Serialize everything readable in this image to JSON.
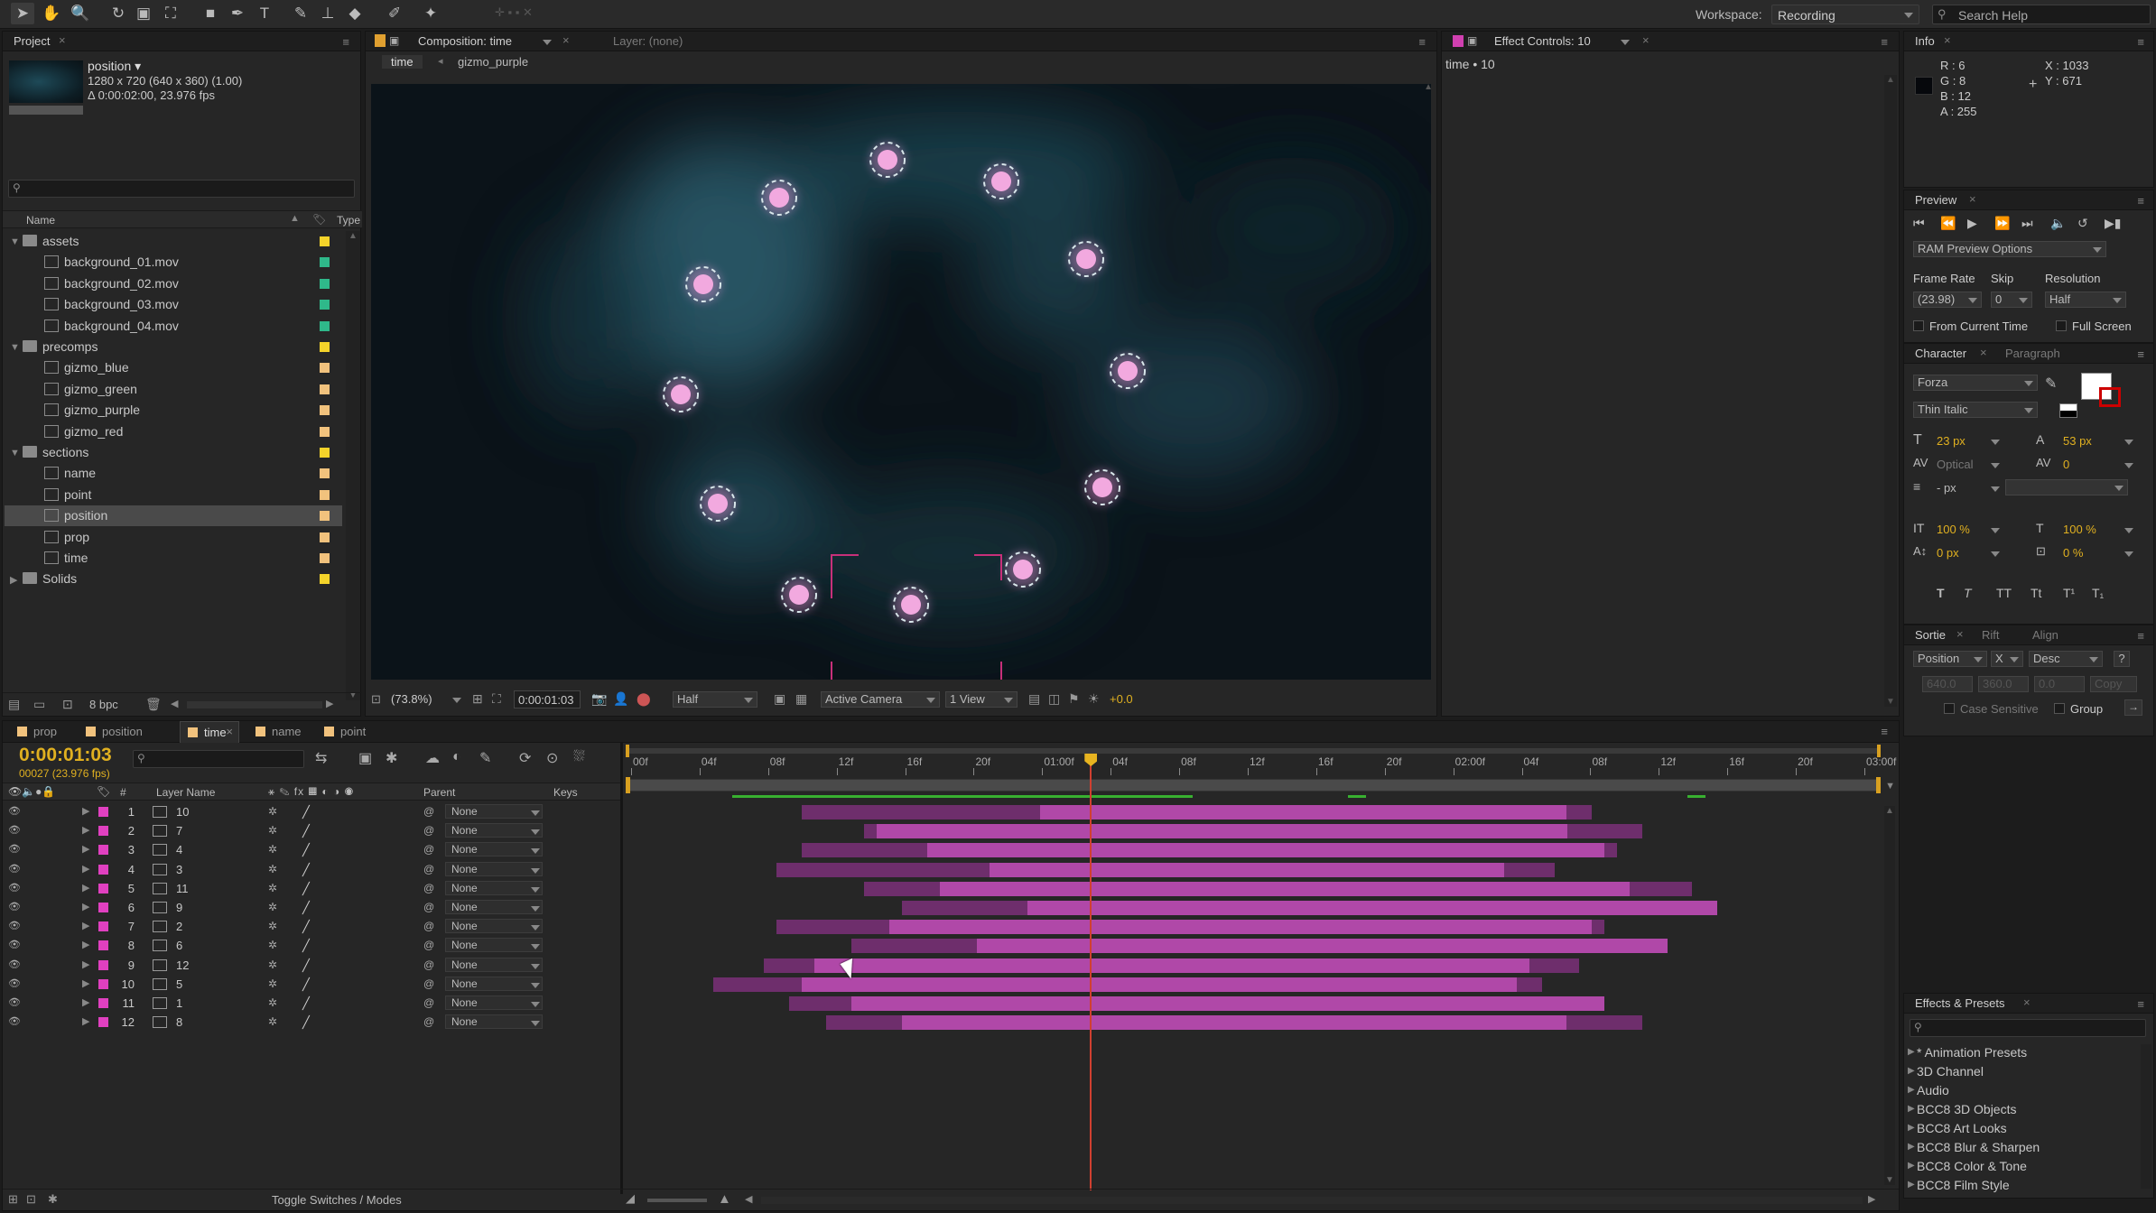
{
  "toolbar": {
    "workspace_label": "Workspace:",
    "workspace_value": "Recording",
    "search_placeholder": "Search Help"
  },
  "project": {
    "tab": "Project",
    "item_name": "position ▾",
    "item_res": "1280 x 720  (640 x 360) (1.00)",
    "item_dur": "Δ 0:00:02:00, 23.976 fps",
    "col_name": "Name",
    "col_type": "Type",
    "bpc": "8 bpc",
    "rows": [
      {
        "label": "assets",
        "kind": "folder",
        "color": "#f4d32a",
        "open": true
      },
      {
        "label": "background_01.mov",
        "kind": "file",
        "color": "#2fb88a"
      },
      {
        "label": "background_02.mov",
        "kind": "file",
        "color": "#2fb88a"
      },
      {
        "label": "background_03.mov",
        "kind": "file",
        "color": "#2fb88a"
      },
      {
        "label": "background_04.mov",
        "kind": "file",
        "color": "#2fb88a"
      },
      {
        "label": "precomps",
        "kind": "folder",
        "color": "#f4d32a",
        "open": true
      },
      {
        "label": "gizmo_blue",
        "kind": "comp",
        "color": "#f1c27d"
      },
      {
        "label": "gizmo_green",
        "kind": "comp",
        "color": "#f1c27d"
      },
      {
        "label": "gizmo_purple",
        "kind": "comp",
        "color": "#f1c27d"
      },
      {
        "label": "gizmo_red",
        "kind": "comp",
        "color": "#f1c27d"
      },
      {
        "label": "sections",
        "kind": "folder",
        "color": "#f4d32a",
        "open": true
      },
      {
        "label": "name",
        "kind": "comp",
        "color": "#f1c27d"
      },
      {
        "label": "point",
        "kind": "comp",
        "color": "#f1c27d"
      },
      {
        "label": "position",
        "kind": "comp",
        "color": "#f1c27d",
        "selected": true
      },
      {
        "label": "prop",
        "kind": "comp",
        "color": "#f1c27d"
      },
      {
        "label": "time",
        "kind": "comp",
        "color": "#f1c27d"
      },
      {
        "label": "Solids",
        "kind": "folder",
        "color": "#f4d32a",
        "open": false
      }
    ]
  },
  "composition": {
    "tab": "Composition: time",
    "layer_tab": "Layer: (none)",
    "crumb_active": "time",
    "crumb_next": "gizmo_purple",
    "zoom": "(73.8%)",
    "timecode": "0:00:01:03",
    "resolution": "Half",
    "camera": "Active Camera",
    "view": "1 View",
    "exposure": "+0.0"
  },
  "effect_controls": {
    "tab": "Effect Controls: 10",
    "title": "time • 10"
  },
  "info": {
    "tab": "Info",
    "r": "R : 6",
    "g": "G : 8",
    "b": "B : 12",
    "a": "A : 255",
    "x": "X : 1033",
    "y": "Y : 671"
  },
  "preview": {
    "tab": "Preview",
    "ram": "RAM Preview Options",
    "frame_rate_label": "Frame Rate",
    "skip_label": "Skip",
    "resolution_label": "Resolution",
    "frame_rate": "(23.98)",
    "skip": "0",
    "resolution": "Half",
    "from_current": "From Current Time",
    "full_screen": "Full Screen"
  },
  "character": {
    "tab": "Character",
    "tab2": "Paragraph",
    "font": "Forza",
    "style": "Thin Italic",
    "size": "23 px",
    "leading": "53 px",
    "kerning": "Optical",
    "tracking": "0",
    "stroke": "- px",
    "vscale": "100 %",
    "hscale": "100 %",
    "baseline": "0 px",
    "tsume": "0 %",
    "type_buttons": [
      "T",
      "T",
      "TT",
      "Tt",
      "T¹",
      "T₁"
    ]
  },
  "sortie": {
    "tab": "Sortie",
    "tab2": "Rift",
    "tab3": "Align",
    "property": "Position",
    "axis": "X",
    "order": "Desc",
    "help": "?",
    "f1": "640.0",
    "f2": "360.0",
    "f3": "0.0",
    "copy": "Copy",
    "case": "Case Sensitive",
    "group": "Group"
  },
  "effects": {
    "tab": "Effects & Presets",
    "items": [
      "* Animation Presets",
      "3D Channel",
      "Audio",
      "BCC8 3D Objects",
      "BCC8 Art Looks",
      "BCC8 Blur & Sharpen",
      "BCC8 Color & Tone",
      "BCC8 Film Style"
    ]
  },
  "timeline": {
    "tabs": [
      {
        "label": "prop",
        "active": false
      },
      {
        "label": "position",
        "active": false
      },
      {
        "label": "time",
        "active": true
      },
      {
        "label": "name",
        "active": false
      },
      {
        "label": "point",
        "active": false
      }
    ],
    "timecode": "0:00:01:03",
    "frames": "00027 (23.976 fps)",
    "col_layer": "Layer Name",
    "col_parent": "Parent",
    "col_keys": "Keys",
    "toggle": "Toggle Switches / Modes",
    "ruler": [
      "00f",
      "04f",
      "08f",
      "12f",
      "16f",
      "20f",
      "01:00f",
      "04f",
      "08f",
      "12f",
      "16f",
      "20f",
      "02:00f",
      "04f",
      "08f",
      "12f",
      "16f",
      "20f",
      "03:00f"
    ],
    "layers": [
      {
        "num": "1",
        "name": "10",
        "parent": "None",
        "outer": [
          0.14,
          0.77
        ],
        "inner": [
          0.33,
          0.75
        ]
      },
      {
        "num": "2",
        "name": "7",
        "parent": "None",
        "outer": [
          0.19,
          0.81
        ],
        "inner": [
          0.2,
          0.75
        ]
      },
      {
        "num": "3",
        "name": "4",
        "parent": "None",
        "outer": [
          0.14,
          0.79
        ],
        "inner": [
          0.24,
          0.78
        ]
      },
      {
        "num": "4",
        "name": "3",
        "parent": "None",
        "outer": [
          0.12,
          0.74
        ],
        "inner": [
          0.29,
          0.7
        ]
      },
      {
        "num": "5",
        "name": "11",
        "parent": "None",
        "outer": [
          0.19,
          0.85
        ],
        "inner": [
          0.25,
          0.8
        ]
      },
      {
        "num": "6",
        "name": "9",
        "parent": "None",
        "outer": [
          0.22,
          0.87
        ],
        "inner": [
          0.32,
          0.87
        ]
      },
      {
        "num": "7",
        "name": "2",
        "parent": "None",
        "outer": [
          0.12,
          0.78
        ],
        "inner": [
          0.21,
          0.77
        ]
      },
      {
        "num": "8",
        "name": "6",
        "parent": "None",
        "outer": [
          0.18,
          0.83
        ],
        "inner": [
          0.28,
          0.83
        ]
      },
      {
        "num": "9",
        "name": "12",
        "parent": "None",
        "outer": [
          0.11,
          0.76
        ],
        "inner": [
          0.15,
          0.72
        ]
      },
      {
        "num": "10",
        "name": "5",
        "parent": "None",
        "outer": [
          0.07,
          0.73
        ],
        "inner": [
          0.14,
          0.71
        ]
      },
      {
        "num": "11",
        "name": "1",
        "parent": "None",
        "outer": [
          0.13,
          0.78
        ],
        "inner": [
          0.18,
          0.78
        ]
      },
      {
        "num": "12",
        "name": "8",
        "parent": "None",
        "outer": [
          0.16,
          0.81
        ],
        "inner": [
          0.22,
          0.75
        ]
      }
    ],
    "cti_fraction": 0.37
  },
  "colors": {
    "accent": "#e0b020",
    "layer_label": "#e040c0",
    "bar_inner": "#b048a8",
    "bar_outer": "#6e2e6c",
    "cti": "#d04030"
  }
}
